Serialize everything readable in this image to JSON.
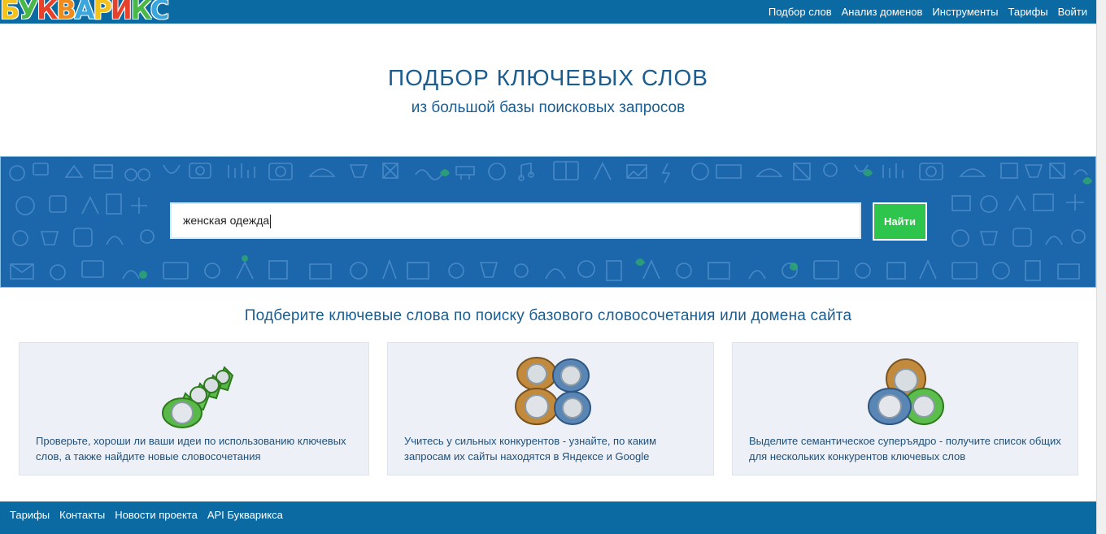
{
  "header": {
    "logo_letters": [
      "Б",
      "У",
      "К",
      "В",
      "А",
      "Р",
      "И",
      "К",
      "С"
    ],
    "logo_colors": [
      "#f3c21c",
      "#4cb749",
      "#e8412b",
      "#f08c1e",
      "#3aa6dd",
      "#f3c21c",
      "#e8412b",
      "#4cb749",
      "#3aa6dd"
    ],
    "nav": [
      {
        "label": "Подбор слов"
      },
      {
        "label": "Анализ доменов"
      },
      {
        "label": "Инструменты"
      },
      {
        "label": "Тарифы"
      },
      {
        "label": "Войти"
      }
    ]
  },
  "hero": {
    "title": "ПОДБОР КЛЮЧЕВЫХ СЛОВ",
    "subtitle": "из большой базы поисковых запросов"
  },
  "search": {
    "value": "женская одежда",
    "button_label": "Найти"
  },
  "tagline": "Подберите ключевые слова по поиску базового словосочетания или домена сайта",
  "cards": [
    {
      "icon": "green-tags-icon",
      "text": "Проверьте, хороши ли ваши идеи по использованию ключевых слов, а также найдите новые словосочетания"
    },
    {
      "icon": "competitor-tags-icon",
      "text": "Учитесь у сильных конкурентов - узнайте, по каким запросам их сайты находятся в Яндексе и Google"
    },
    {
      "icon": "semantic-core-icon",
      "text": "Выделите семантическое суперъядро - получите список общих для нескольких конкурентов ключевых слов"
    }
  ],
  "footer": {
    "links": [
      {
        "label": "Тарифы"
      },
      {
        "label": "Контакты"
      },
      {
        "label": "Новости проекта"
      },
      {
        "label": "API Букварикса"
      }
    ]
  },
  "colors": {
    "header_bg": "#0b6aa2",
    "band_bg": "#1c67ac",
    "button_green": "#2dc54b",
    "text_blue": "#1c5d8f",
    "card_bg": "#edf1f7"
  }
}
